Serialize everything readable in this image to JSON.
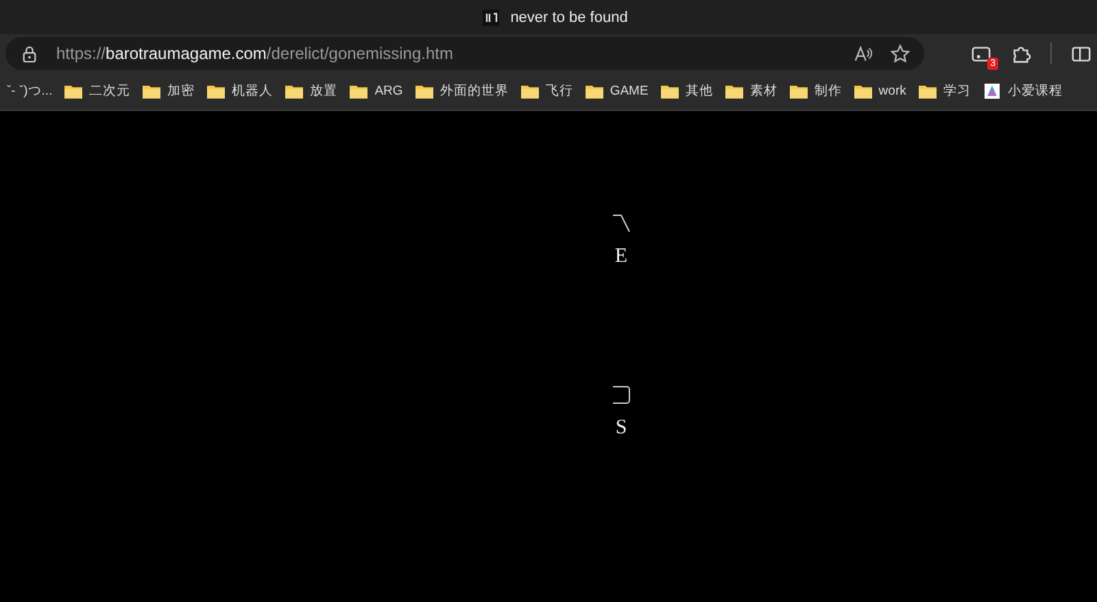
{
  "window": {
    "title": "never to be found"
  },
  "address_bar": {
    "scheme": "https://",
    "host": "barotraumagame.com",
    "path": "/derelict/gonemissing.htm"
  },
  "extension_badge": "3",
  "bookmarks": [
    {
      "kind": "link",
      "label": "ˇ- ˇ)つ..."
    },
    {
      "kind": "folder",
      "label": "二次元"
    },
    {
      "kind": "folder",
      "label": "加密"
    },
    {
      "kind": "folder",
      "label": "机器人"
    },
    {
      "kind": "folder",
      "label": "放置"
    },
    {
      "kind": "folder",
      "label": "ARG"
    },
    {
      "kind": "folder",
      "label": "外面的世界"
    },
    {
      "kind": "folder",
      "label": "飞行"
    },
    {
      "kind": "folder",
      "label": "GAME"
    },
    {
      "kind": "folder",
      "label": "其他"
    },
    {
      "kind": "folder",
      "label": "素材"
    },
    {
      "kind": "folder",
      "label": "制作"
    },
    {
      "kind": "folder",
      "label": "work"
    },
    {
      "kind": "folder",
      "label": "学习"
    },
    {
      "kind": "app",
      "label": "小爱课程"
    }
  ],
  "page": {
    "marks": [
      {
        "kind": "slash",
        "letter": "E"
      },
      {
        "kind": "bracket",
        "letter": "S"
      }
    ]
  }
}
